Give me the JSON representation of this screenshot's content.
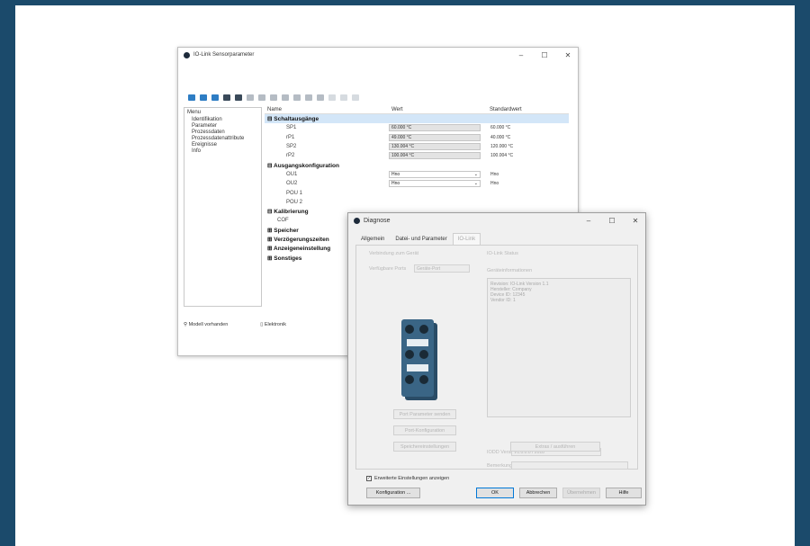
{
  "main_window": {
    "title": "IO-Link Sensorparameter",
    "controls": {
      "min": "–",
      "max": "☐",
      "close": "✕"
    },
    "menu": {
      "header": "Menu",
      "items": [
        "Identifikation",
        "Parameter",
        "Prozessdaten",
        "Prozessdatenattribute",
        "Ereignisse",
        "Info"
      ]
    },
    "grid": {
      "columns": [
        "Name",
        "Wert",
        "Standardwert"
      ],
      "rows": [
        {
          "type": "group",
          "name": "Schaltausgänge",
          "selected": true
        },
        {
          "type": "value",
          "name": "SP1",
          "value": "60.000 °C",
          "default": "60.000 °C"
        },
        {
          "type": "value",
          "name": "rP1",
          "value": "49.000 °C",
          "default": "40.000 °C"
        },
        {
          "type": "value",
          "name": "SP2",
          "value": "130.004 °C",
          "default": "120.000 °C"
        },
        {
          "type": "value",
          "name": "rP2",
          "value": "100.004 °C",
          "default": "100.004 °C"
        },
        {
          "type": "group",
          "name": "Ausgangskonfiguration"
        },
        {
          "type": "dropdown",
          "name": "OU1",
          "value": "Hno",
          "default": "Hno"
        },
        {
          "type": "dropdown",
          "name": "OU2",
          "value": "Hno",
          "default": "Hno"
        },
        {
          "type": "plain",
          "name": "POU 1"
        },
        {
          "type": "plain",
          "name": "POU 2"
        },
        {
          "type": "group",
          "name": "Kalibrierung"
        },
        {
          "type": "plain",
          "name": "COF"
        },
        {
          "type": "group",
          "name": "Speicher"
        },
        {
          "type": "group",
          "name": "Verzögerungszeiten"
        },
        {
          "type": "group",
          "name": "Anzeigeneinstellung"
        },
        {
          "type": "group",
          "name": "Sonstiges"
        }
      ]
    },
    "status": {
      "left": "Modell vorhanden",
      "right": "Elektronik"
    }
  },
  "dialog": {
    "title": "Diagnose",
    "controls": {
      "min": "–",
      "max": "☐",
      "close": "✕"
    },
    "tabs": [
      "Allgemein",
      "Datei- und Parameter",
      "IO-Link"
    ],
    "faint_labels": {
      "top_left": "Verbindung zum Gerät",
      "mode_label": "Verfügbare Ports",
      "mode_value": "Geräte-Port",
      "top_right": "IO-Link Status",
      "info_header": "Geräteinformationen",
      "serial_label": "IODD Version",
      "serial_value": "V1.0.0.0 / 2018",
      "note_label": "Bemerkung"
    },
    "info_lines": [
      "Revision: IO-Link Version 1.1",
      "Hersteller: Company",
      "Device ID: 12345",
      "Vendor ID: 1"
    ],
    "faint_buttons": [
      "Port Parameter senden",
      "Port-Konfiguration",
      "Speichereinstellungen",
      "Extras / ausführen"
    ],
    "checkbox": {
      "label": "Erweiterte Einstellungen anzeigen",
      "checked": true
    },
    "buttons": {
      "configure": "Konfiguration ...",
      "ok": "OK",
      "cancel": "Abbrechen",
      "apply": "Übernehmen",
      "help": "Hilfe"
    }
  }
}
